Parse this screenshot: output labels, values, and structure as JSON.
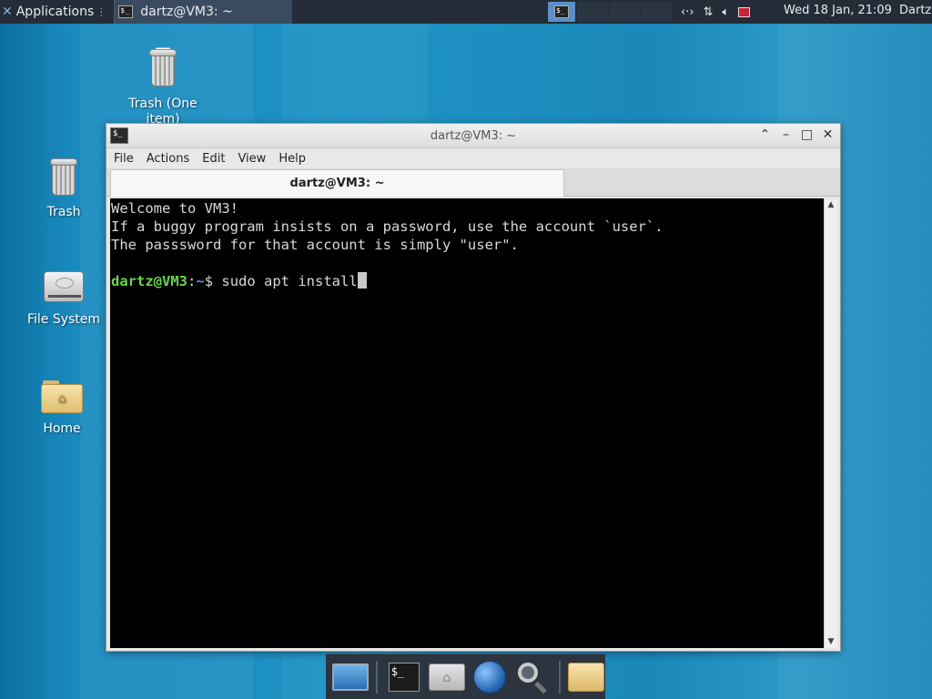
{
  "top_panel": {
    "applications_label": "Applications",
    "task_label": "dartz@VM3: ~",
    "clock": "Wed 18 Jan, 21:09",
    "user": "Dartz",
    "tray_icons": [
      "network-arrows-icon",
      "transfer-icon",
      "volume-icon",
      "record-icon"
    ]
  },
  "desktop": {
    "icons": [
      {
        "label": "Trash (One item)",
        "icon": "trash-full-icon"
      },
      {
        "label": "Trash",
        "icon": "trash-icon"
      },
      {
        "label": "File System",
        "icon": "drive-icon"
      },
      {
        "label": "Home",
        "icon": "home-folder-icon"
      }
    ]
  },
  "terminal": {
    "title": "dartz@VM3: ~",
    "menu": [
      "File",
      "Actions",
      "Edit",
      "View",
      "Help"
    ],
    "tab_label": "dartz@VM3: ~",
    "lines": [
      "Welcome to VM3!",
      "If a buggy program insists on a password, use the account `user`.",
      "The passsword for that account is simply \"user\"."
    ],
    "prompt_user": "dartz@VM3",
    "prompt_sep": ":",
    "prompt_path": "~",
    "prompt_symbol": "$",
    "command": " sudo apt install"
  },
  "dock": {
    "items": [
      "show-desktop-icon",
      "terminal-icon",
      "home-icon",
      "web-browser-icon",
      "search-icon",
      "folder-icon"
    ]
  },
  "colors": {
    "desktop_bg": "#1e93c4",
    "panel_bg": "#232c37",
    "prompt_user": "#69d74f",
    "prompt_path": "#5b8ef0"
  }
}
